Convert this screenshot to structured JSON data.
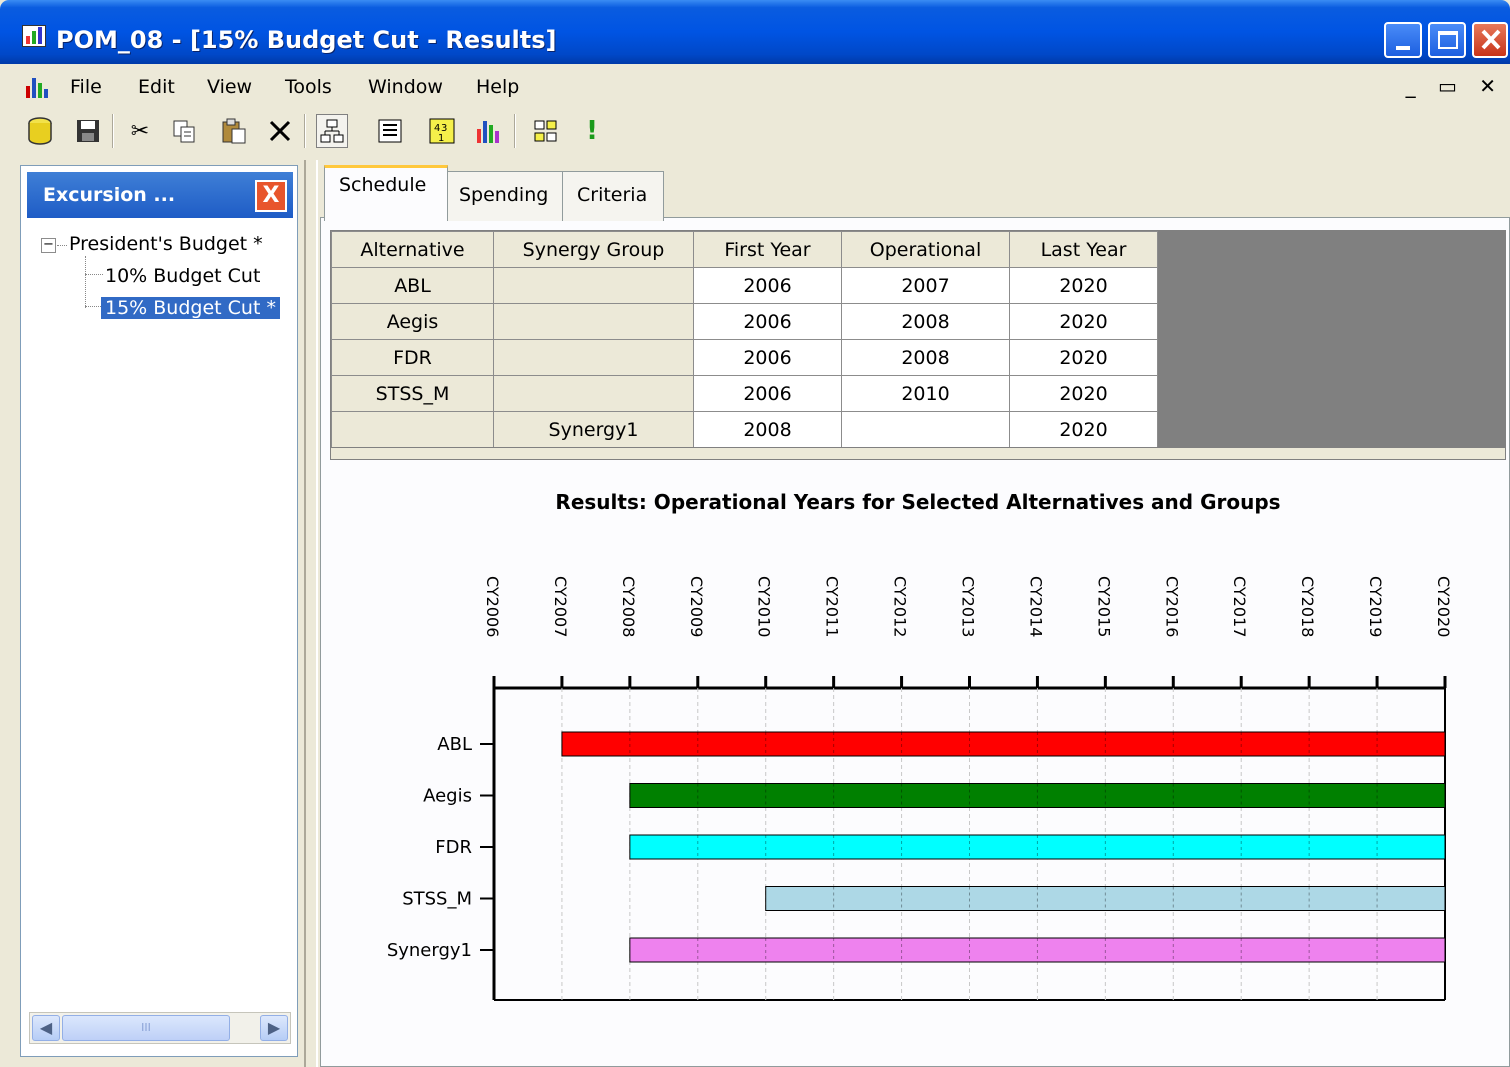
{
  "window": {
    "title": "POM_08 - [15% Budget Cut - Results]",
    "mdi_controls": "_ ▭ ✕"
  },
  "menu": [
    "File",
    "Edit",
    "View",
    "Tools",
    "Window",
    "Help"
  ],
  "toolbar": {
    "tools": [
      "database-icon",
      "save-icon",
      "cut-icon",
      "copy-icon",
      "paste-icon",
      "delete-icon",
      "hierarchy-icon",
      "list-icon",
      "numbers-icon",
      "chart-icon",
      "layout-icon",
      "run-icon"
    ]
  },
  "panel": {
    "title": "Excursion ...",
    "close_label": "X",
    "tree": {
      "root": "President's Budget *",
      "expander": "−",
      "children": [
        "10% Budget Cut",
        "15% Budget Cut *"
      ],
      "selected_index": 1
    },
    "scroll_grip": "III"
  },
  "tabs": [
    "Schedule",
    "Spending",
    "Criteria"
  ],
  "active_tab": 0,
  "schedule": {
    "columns": [
      "Alternative",
      "Synergy Group",
      "First Year",
      "Operational",
      "Last Year"
    ],
    "rows": [
      [
        "ABL",
        "",
        "2006",
        "2007",
        "2020"
      ],
      [
        "Aegis",
        "",
        "2006",
        "2008",
        "2020"
      ],
      [
        "FDR",
        "",
        "2006",
        "2008",
        "2020"
      ],
      [
        "STSS_M",
        "",
        "2006",
        "2010",
        "2020"
      ],
      [
        "",
        "Synergy1",
        "2008",
        "",
        "2020"
      ]
    ]
  },
  "chart_title": "Results:  Operational Years for Selected Alternatives and Groups",
  "chart_data": {
    "type": "gantt",
    "title": "Results:  Operational Years for Selected Alternatives and Groups",
    "x_ticks": [
      "CY2006",
      "CY2007",
      "CY2008",
      "CY2009",
      "CY2010",
      "CY2011",
      "CY2012",
      "CY2013",
      "CY2014",
      "CY2015",
      "CY2016",
      "CY2017",
      "CY2018",
      "CY2019",
      "CY2020"
    ],
    "xlim": [
      2006,
      2020
    ],
    "grid": true,
    "bars": [
      {
        "name": "ABL",
        "start": 2007,
        "end": 2020,
        "color": "#ff0000"
      },
      {
        "name": "Aegis",
        "start": 2008,
        "end": 2020,
        "color": "#008000"
      },
      {
        "name": "FDR",
        "start": 2008,
        "end": 2020,
        "color": "#00ffff"
      },
      {
        "name": "STSS_M",
        "start": 2010,
        "end": 2020,
        "color": "#add8e6"
      },
      {
        "name": "Synergy1",
        "start": 2008,
        "end": 2020,
        "color": "#ee82ee"
      }
    ]
  },
  "colors": {
    "titlebar": "#0054e3",
    "selection": "#316ac5",
    "chrome": "#ece9d8"
  }
}
